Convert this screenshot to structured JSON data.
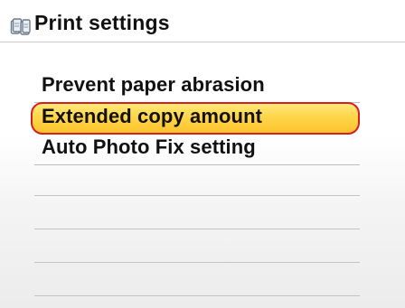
{
  "header": {
    "title": "Print settings",
    "icon": "printer-settings-icon"
  },
  "menu": {
    "items": [
      {
        "label": "Prevent paper abrasion",
        "selected": false
      },
      {
        "label": "Extended copy amount",
        "selected": true
      },
      {
        "label": "Auto Photo Fix setting",
        "selected": false
      }
    ],
    "empty_rows": 4
  },
  "colors": {
    "highlight_fill": "#fed33d",
    "highlight_border": "#d51f23",
    "text": "#111111",
    "rule": "#c4c4c4"
  }
}
